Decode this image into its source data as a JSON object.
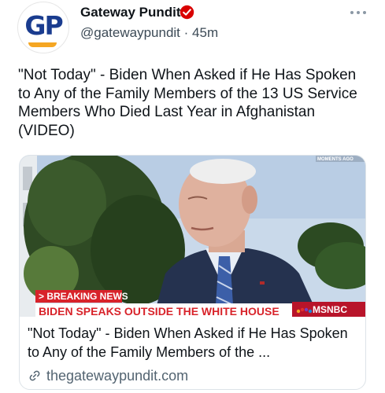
{
  "author": {
    "display_name": "Gateway Pundit",
    "handle": "@gatewaypundit",
    "separator": "·",
    "time_ago": "45m",
    "avatar_text": "GP",
    "verified_color": "#d90000"
  },
  "tweet": {
    "text": "\"Not Today\" - Biden When Asked if He Has Spoken to Any of the Family Members of the 13 US Service Members Who Died Last Year in Afghanistan (VIDEO)"
  },
  "card": {
    "media": {
      "top_corner_text": "MOMENTS AGO",
      "breaking_label": "> BREAKING NEWS",
      "headline": "BIDEN SPEAKS OUTSIDE THE WHITE HOUSE",
      "network": "MSNBC"
    },
    "title": "\"Not Today\" - Biden When Asked if He Has Spoken to Any of the Family Members of the ...",
    "domain": "thegatewaypundit.com"
  },
  "icons": {
    "more": "more-options-icon",
    "verified": "verified-badge-icon",
    "link": "link-icon"
  },
  "colors": {
    "text_primary": "#0f1419",
    "text_secondary": "#536471",
    "card_border": "#dde3e8",
    "breaking_red": "#d8232a"
  }
}
